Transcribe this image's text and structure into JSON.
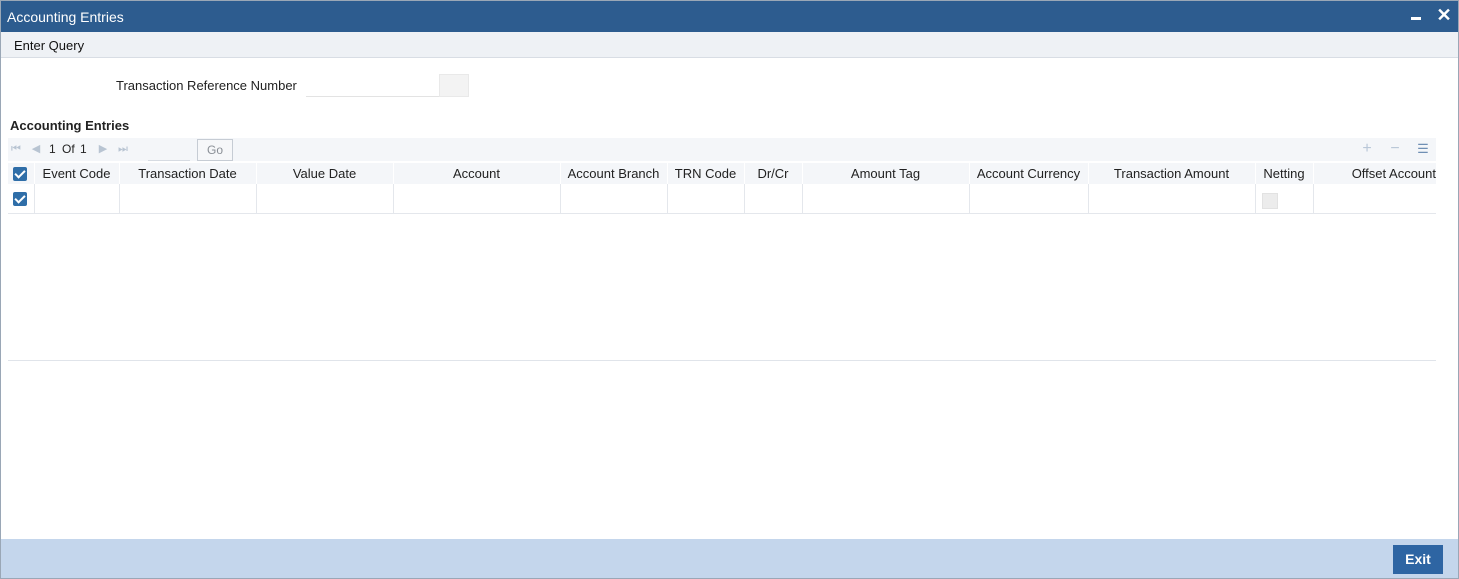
{
  "window": {
    "title": "Accounting Entries",
    "minimize_icon": "minimize-icon",
    "close_symbol": "✕"
  },
  "menu": {
    "enter_query": "Enter Query"
  },
  "form": {
    "trn_ref_label": "Transaction Reference Number",
    "trn_ref_value": ""
  },
  "section": {
    "title": "Accounting Entries"
  },
  "pager": {
    "current": "1",
    "of": "Of",
    "total": "1",
    "go_label": "Go"
  },
  "grid": {
    "columns": [
      "Event Code",
      "Transaction Date",
      "Value Date",
      "Account",
      "Account Branch",
      "TRN Code",
      "Dr/Cr",
      "Amount Tag",
      "Account Currency",
      "Transaction Amount",
      "Netting",
      "Offset Account"
    ],
    "rows": [
      {
        "selected": true,
        "cells": [
          "",
          "",
          "",
          "",
          "",
          "",
          "",
          "",
          "",
          "",
          "",
          ""
        ]
      }
    ]
  },
  "footer": {
    "exit_label": "Exit"
  },
  "colors": {
    "titlebar": "#2d5c8f",
    "footer": "#c4d6ec",
    "button": "#2e65a3",
    "checkbox": "#2f6ea8"
  }
}
